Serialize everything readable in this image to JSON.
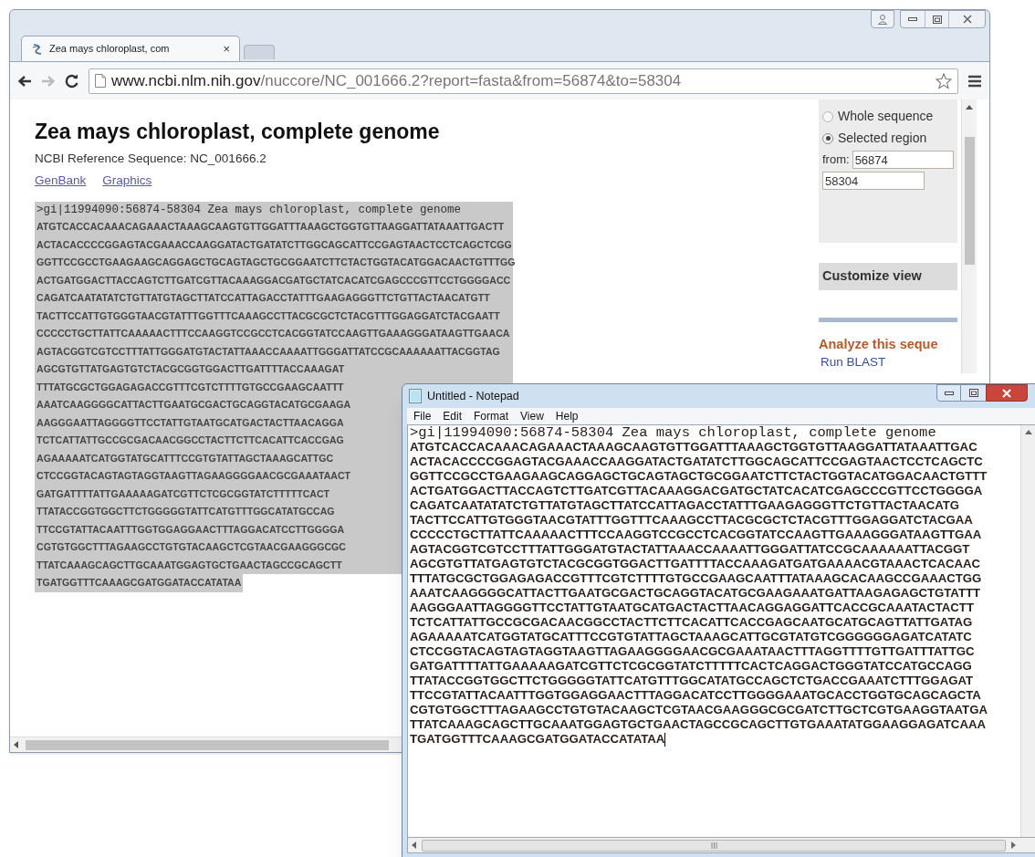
{
  "browser": {
    "tab": {
      "title": "Zea mays chloroplast, com",
      "close": "×"
    },
    "url": {
      "host": "www.ncbi.nlm.nih.gov",
      "path": "/nuccore/NC_001666.2?report=fasta&from=56874&to=58304"
    },
    "page": {
      "title": "Zea mays chloroplast, complete genome",
      "subtitle": "NCBI Reference Sequence: NC_001666.2",
      "links": [
        "GenBank",
        "Graphics"
      ],
      "fasta": {
        "header": ">gi|11994090:56874-58304 Zea mays chloroplast, complete genome",
        "lines": [
          "ATGTCACCACAAACAGAAACTAAAGCAAGTGTTGGATTTAAAGCTGGTGTTAAGGATTATAAATTGACTT",
          "ACTACACCCCGGAGTACGAAACCAAGGATACTGATATCTTGGCAGCATTCCGAGTAACTCCTCAGCTCGG",
          "GGTTCCGCCTGAAGAAGCAGGAGCTGCAGTAGCTGCGGAATCTTCTACTGGTACATGGACAACTGTTTGG",
          "ACTGATGGACTTACCAGTCTTGATCGTTACAAAGGACGATGCTATCACATCGAGCCCGTTCCTGGGGACC",
          "CAGATCAATATATCTGTTATGTAGCTTATCCATTAGACCTATTTGAAGAGGGTTCTGTTACTAACATGTT",
          "TACTTCCATTGTGGGTAACGTATTTGGTTTCAAAGCCTTACGCGCTCTACGTTTGGAGGATCTACGAATT",
          "CCCCCTGCTTATTCAAAAACTTTCCAAGGTCCGCCTCACGGTATCCAAGTTGAAAGGGATAAGTTGAACA",
          "AGTACGGTCGTCCTTTATTGGGATGTACTATTAAACCAAAATTGGGATTATCCGCAAAAAATTACGGTAG",
          "AGCGTGTTATGAGTGTCTACGCGGTGGACTTGATTTTACCAAAGAT",
          "TTTATGCGCTGGAGAGACCGTTTCGTCTTTTGTGCCGAAGCAATTT",
          "AAATCAAGGGGCATTACTTGAATGCGACTGCAGGTACATGCGAAGA",
          "AAGGGAATTAGGGGTTCCTATTGTAATGCATGACTACTTAACAGGA",
          "TCTCATTATTGCCGCGACAACGGCCTACTTCTTCACATTCACCGAG",
          "AGAAAAATCATGGTATGCATTTCCGTGTATTAGCTAAAGCATTGC",
          "CTCCGGTACAGTAGTAGGTAAGTTAGAAGGGGAACGCGAAATAACT",
          "GATGATTTTATTGAAAAAGATCGTTCTCGCGGTATCTTTTTCACT",
          "TTATACCGGTGGCTTCTGGGGGTATTCATGTTTGGCATATGCCAG",
          "TTCCGTATTACAATTTGGTGGAGGAACTTTAGGACATCCTTGGGGA",
          "CGTGTGGCTTTAGAAGCCTGTGTACAAGCTCGTAACGAAGGGCGC",
          "TTATCAAAGCAGCTTGCAAATGGAGTGCTGAACTAGCCGCAGCTT",
          "TGATGGTTTCAAAGCGATGGATACCATATAA"
        ]
      }
    },
    "sidebar": {
      "region_options": [
        {
          "label": "Whole sequence",
          "selected": false
        },
        {
          "label": "Selected region",
          "selected": true
        }
      ],
      "from_label": "from:",
      "from_value": "56874",
      "to_value": "58304",
      "customize_heading": "Customize view",
      "analyze_heading": "Analyze this seque",
      "analyze_links": [
        "Run BLAST"
      ]
    }
  },
  "notepad": {
    "title": "Untitled - Notepad",
    "menu": [
      "File",
      "Edit",
      "Format",
      "View",
      "Help"
    ],
    "header": ">gi|11994090:56874-58304 Zea mays chloroplast, complete genome",
    "lines": [
      "ATGTCACCACAAACAGAAACTAAAGCAAGTGTTGGATTTAAAGCTGGTGTTAAGGATTATAAATTGAC",
      "ACTACACCCCGGAGTACGAAACCAAGGATACTGATATCTTGGCAGCATTCCGAGTAACTCCTCAGCTC",
      "GGTTCCGCCTGAAGAAGCAGGAGCTGCAGTAGCTGCGGAATCTTCTACTGGTACATGGACAACTGTTT",
      "ACTGATGGACTTACCAGTCTTGATCGTTACAAAGGACGATGCTATCACATCGAGCCCGTTCCTGGGGA",
      "CAGATCAATATATCTGTTATGTAGCTTATCCATTAGACCTATTTGAAGAGGGTTCTGTTACTAACATG",
      "TACTTCCATTGTGGGTAACGTATTTGGTTTCAAAGCCTTACGCGCTCTACGTTTGGAGGATCTACGAA",
      "CCCCCTGCTTATTCAAAAACTTTCCAAGGTCCGCCTCACGGTATCCAAGTTGAAAGGGATAAGTTGAA",
      "AGTACGGTCGTCCTTTATTGGGATGTACTATTAAACCAAAATTGGGATTATCCGCAAAAAATTACGGT",
      "AGCGTGTTATGAGTGTCTACGCGGTGGACTTGATTTTACCAAAGATGATGAAAACGTAAACTCACAAC",
      "TTTATGCGCTGGAGAGACCGTTTCGTCTTTTGTGCCGAAGCAATTTATAAAGCACAAGCCGAAACTGG",
      "AAATCAAGGGGCATTACTTGAATGCGACTGCAGGTACATGCGAAGAAATGATTAAGAGAGCTGTATTT",
      "AAGGGAATTAGGGGTTCCTATTGTAATGCATGACTACTTAACAGGAGGATTCACCGCAAATACTACTT",
      "TCTCATTATTGCCGCGACAACGGCCTACTTCTTCACATTCACCGAGCAATGCATGCAGTTATTGATAG",
      "AGAAAAATCATGGTATGCATTTCCGTGTATTAGCTAAAGCATTGCGTATGTCGGGGGGAGATCATATC",
      "CTCCGGTACAGTAGTAGGTAAGTTAGAAGGGGAACGCGAAATAACTTTAGGTTTTGTTGATTTATTGC",
      "GATGATTTTATTGAAAAAGATCGTTCTCGCGGTATCTTTTTCACTCAGGACTGGGTATCCATGCCAGG",
      "TTATACCGGTGGCTTCTGGGGGTATTCATGTTTGGCATATGCCAGCTCTGACCGAAATCTTTGGAGAT",
      "TTCCGTATTACAATTTGGTGGAGGAACTTTAGGACATCCTTGGGGAAATGCACCTGGTGCAGCAGCTA",
      "CGTGTGGCTTTAGAAGCCTGTGTACAAGCTCGTAACGAAGGGCGCGATCTTGCTCGTGAAGGTAATGA",
      "TTATCAAAGCAGCTTGCAAATGGAGTGCTGAACTAGCCGCAGCTTGTGAAATATGGAAGGAGATCAAA",
      "TGATGGTTTCAAAGCGATGGATACCATATAA"
    ]
  }
}
